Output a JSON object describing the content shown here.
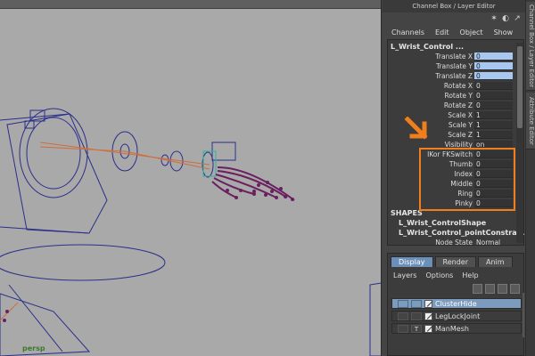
{
  "window": {
    "title": "Channel Box / Layer Editor"
  },
  "viewport": {
    "camera_label": "persp"
  },
  "side_tabs": [
    "Channel Box / Layer Editor",
    "Attribute Editor"
  ],
  "channel_box": {
    "menu": [
      "Channels",
      "Edit",
      "Object",
      "Show"
    ],
    "node_name": "L_Wrist_Control ...",
    "attributes": [
      {
        "label": "Translate X",
        "value": "0",
        "selected": true
      },
      {
        "label": "Translate Y",
        "value": "0",
        "selected": true
      },
      {
        "label": "Translate Z",
        "value": "0",
        "selected": true
      },
      {
        "label": "Rotate X",
        "value": "0",
        "selected": false
      },
      {
        "label": "Rotate Y",
        "value": "0",
        "selected": false
      },
      {
        "label": "Rotate Z",
        "value": "0",
        "selected": false
      },
      {
        "label": "Scale X",
        "value": "1",
        "selected": false
      },
      {
        "label": "Scale Y",
        "value": "1",
        "selected": false
      },
      {
        "label": "Scale Z",
        "value": "1",
        "selected": false
      },
      {
        "label": "Visibility",
        "value": "on",
        "selected": false
      },
      {
        "label": "IKor FKSwitch",
        "value": "0",
        "selected": false
      },
      {
        "label": "Thumb",
        "value": "0",
        "selected": false
      },
      {
        "label": "Index",
        "value": "0",
        "selected": false
      },
      {
        "label": "Middle",
        "value": "0",
        "selected": false
      },
      {
        "label": "Ring",
        "value": "0",
        "selected": false
      },
      {
        "label": "Pinky",
        "value": "0",
        "selected": false
      }
    ],
    "shapes_header": "SHAPES",
    "shapes": [
      "L_Wrist_ControlShape",
      "L_Wrist_Control_pointConstrai..."
    ],
    "node_state": {
      "label": "Node State",
      "value": "Normal"
    }
  },
  "layer_editor": {
    "tabs": [
      "Display",
      "Render",
      "Anim"
    ],
    "active_tab": "Display",
    "menu": [
      "Layers",
      "Options",
      "Help"
    ],
    "layers": [
      {
        "name": "ClusterHide",
        "selected": true,
        "flag": ""
      },
      {
        "name": "LegLockJoint",
        "selected": false,
        "flag": ""
      },
      {
        "name": "ManMesh",
        "selected": false,
        "flag": "T"
      }
    ]
  },
  "colors": {
    "highlight": "#f07e1c",
    "selection": "#a9c8ef",
    "layer_selected": "#7d9bbd"
  }
}
